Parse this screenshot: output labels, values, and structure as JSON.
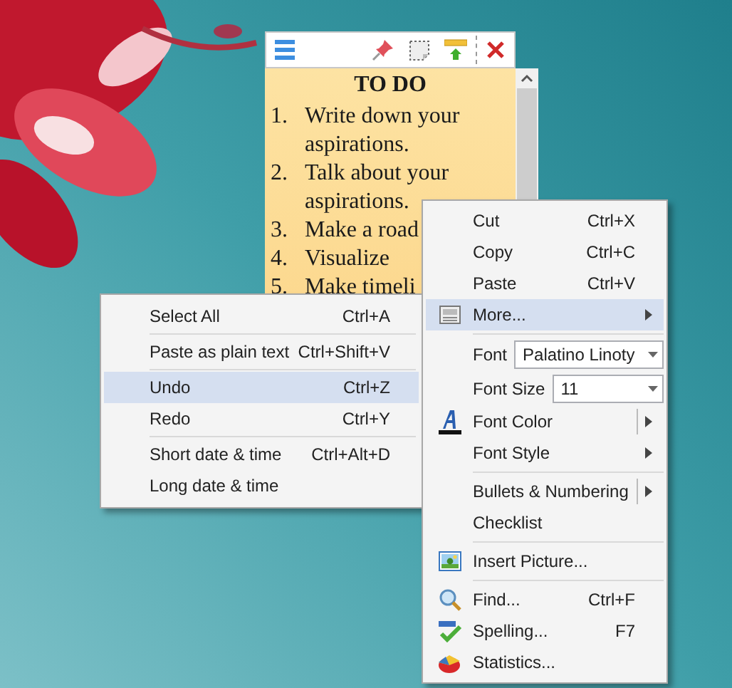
{
  "note": {
    "title": "TO DO",
    "items": [
      {
        "number": "1.",
        "text": "Write down your aspirations."
      },
      {
        "number": "2.",
        "text": "Talk about your aspirations."
      },
      {
        "number": "3.",
        "text": "Make a road"
      },
      {
        "number": "4.",
        "text": "Visualize"
      },
      {
        "number": "5.",
        "text": "Make timeli"
      }
    ]
  },
  "context_menu": {
    "items": [
      {
        "kind": "item",
        "label": "Cut",
        "shortcut": "Ctrl+X",
        "selected": false
      },
      {
        "kind": "item",
        "label": "Copy",
        "shortcut": "Ctrl+C",
        "selected": false
      },
      {
        "kind": "item",
        "label": "Paste",
        "shortcut": "Ctrl+V",
        "selected": false
      },
      {
        "kind": "submenu",
        "label": "More...",
        "selected": true
      },
      {
        "kind": "separator"
      },
      {
        "kind": "combo",
        "label": "Font",
        "value": "Palatino Linoty"
      },
      {
        "kind": "combo",
        "label": "Font Size",
        "value": "11"
      },
      {
        "kind": "split",
        "label": "Font Color",
        "selected": false
      },
      {
        "kind": "submenu",
        "label": "Font Style",
        "selected": false
      },
      {
        "kind": "separator"
      },
      {
        "kind": "split",
        "label": "Bullets & Numbering",
        "selected": false
      },
      {
        "kind": "item",
        "label": "Checklist",
        "selected": false
      },
      {
        "kind": "separator"
      },
      {
        "kind": "item",
        "label": "Insert Picture...",
        "selected": false
      },
      {
        "kind": "separator"
      },
      {
        "kind": "item",
        "label": "Find...",
        "shortcut": "Ctrl+F",
        "selected": false
      },
      {
        "kind": "item",
        "label": "Spelling...",
        "shortcut": "F7",
        "selected": false
      },
      {
        "kind": "item",
        "label": "Statistics...",
        "selected": false
      }
    ]
  },
  "submenu": {
    "items": [
      {
        "kind": "item",
        "label": "Select All",
        "shortcut": "Ctrl+A",
        "selected": false
      },
      {
        "kind": "separator"
      },
      {
        "kind": "item",
        "label": "Paste as plain text",
        "shortcut": "Ctrl+Shift+V",
        "selected": false
      },
      {
        "kind": "separator"
      },
      {
        "kind": "item",
        "label": "Undo",
        "shortcut": "Ctrl+Z",
        "selected": true
      },
      {
        "kind": "item",
        "label": "Redo",
        "shortcut": "Ctrl+Y",
        "selected": false
      },
      {
        "kind": "separator"
      },
      {
        "kind": "item",
        "label": "Short date & time",
        "shortcut": "Ctrl+Alt+D",
        "selected": false
      },
      {
        "kind": "item",
        "label": "Long date & time",
        "selected": false
      }
    ]
  }
}
